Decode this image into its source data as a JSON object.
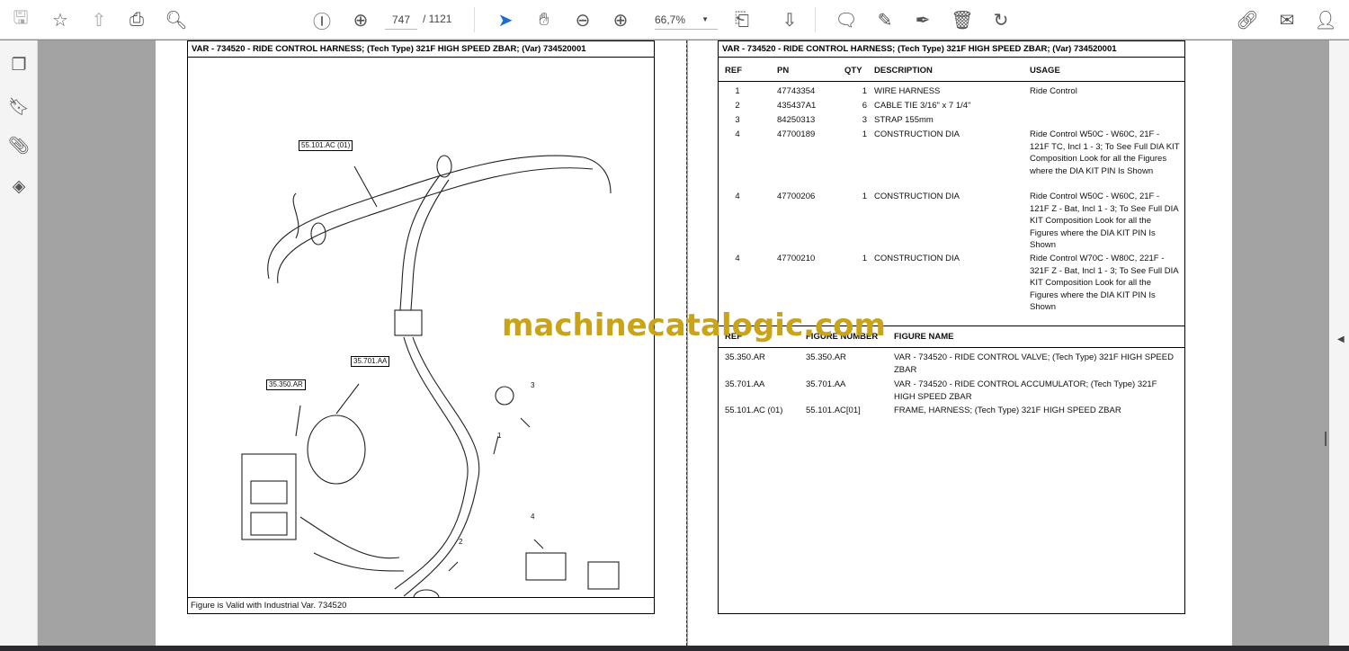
{
  "toolbar": {
    "page_current": "747",
    "page_total": "/ 1121",
    "zoom": "66,7%",
    "icons": [
      "save-icon",
      "star-icon",
      "upload-icon",
      "print-icon",
      "find-icon",
      "page-up-icon",
      "page-down-icon",
      "select-cursor-icon",
      "hand-icon",
      "zoom-out-icon",
      "zoom-in-icon",
      "fit-page-icon",
      "scroll-mode-icon",
      "comment-icon",
      "highlight-icon",
      "sign-icon",
      "delete-icon",
      "rotate-icon",
      "share-link-icon",
      "email-icon",
      "add-user-icon"
    ]
  },
  "sidebar": {
    "icons": [
      "pages-icon",
      "bookmark-icon",
      "attachment-icon",
      "layers-icon"
    ]
  },
  "left_page": {
    "header": "VAR - 734520 - RIDE CONTROL HARNESS; (Tech Type) 321F HIGH SPEED ZBAR; (Var) 734520001",
    "callouts": [
      "55.101.AC (01)",
      "35.701.AA",
      "35.350.AR",
      "1",
      "2",
      "3",
      "4"
    ],
    "footer": "Figure is Valid with Industrial Var. 734520"
  },
  "right_page": {
    "header": "VAR - 734520 - RIDE CONTROL HARNESS; (Tech Type) 321F HIGH SPEED ZBAR; (Var) 734520001",
    "columns": [
      "REF",
      "PN",
      "QTY",
      "DESCRIPTION",
      "USAGE"
    ],
    "rows": [
      {
        "ref": "1",
        "pn": "47743354",
        "qty": "1",
        "desc": "WIRE HARNESS",
        "usage": "Ride Control"
      },
      {
        "ref": "2",
        "pn": "435437A1",
        "qty": "6",
        "desc": "CABLE TIE 3/16\" x 7 1/4\"",
        "usage": ""
      },
      {
        "ref": "3",
        "pn": "84250313",
        "qty": "3",
        "desc": "STRAP 155mm",
        "usage": ""
      },
      {
        "ref": "4",
        "pn": "47700189",
        "qty": "1",
        "desc": "CONSTRUCTION DIA",
        "usage": "Ride Control W50C - W60C, 21F - 121F TC, Incl 1 - 3; To See Full DIA KIT Composition Look for all the Figures where the DIA KIT PIN Is Shown"
      },
      {
        "ref": "4",
        "pn": "47700206",
        "qty": "1",
        "desc": "CONSTRUCTION DIA",
        "usage": "Ride Control W50C - W60C, 21F - 121F Z - Bat, Incl 1 - 3; To See Full DIA KIT Composition Look for all the Figures where the DIA KIT PIN Is Shown"
      },
      {
        "ref": "4",
        "pn": "47700210",
        "qty": "1",
        "desc": "CONSTRUCTION DIA",
        "usage": "Ride Control W70C - W80C, 221F - 321F Z - Bat, Incl 1 - 3; To See Full DIA KIT Composition Look for all the Figures where the DIA KIT PIN Is Shown"
      }
    ],
    "fig_columns": [
      "REF",
      "FIGURE NUMBER",
      "FIGURE NAME"
    ],
    "fig_rows": [
      {
        "ref": "35.350.AR",
        "num": "35.350.AR",
        "name": "VAR - 734520 - RIDE CONTROL VALVE; (Tech Type) 321F HIGH SPEED ZBAR"
      },
      {
        "ref": "35.701.AA",
        "num": "35.701.AA",
        "name": "VAR - 734520 - RIDE CONTROL ACCUMULATOR; (Tech Type) 321F HIGH SPEED ZBAR"
      },
      {
        "ref": "55.101.AC (01)",
        "num": "55.101.AC[01]",
        "name": "FRAME, HARNESS; (Tech Type) 321F HIGH SPEED ZBAR"
      }
    ]
  },
  "watermark": "machinecatalogic.com"
}
